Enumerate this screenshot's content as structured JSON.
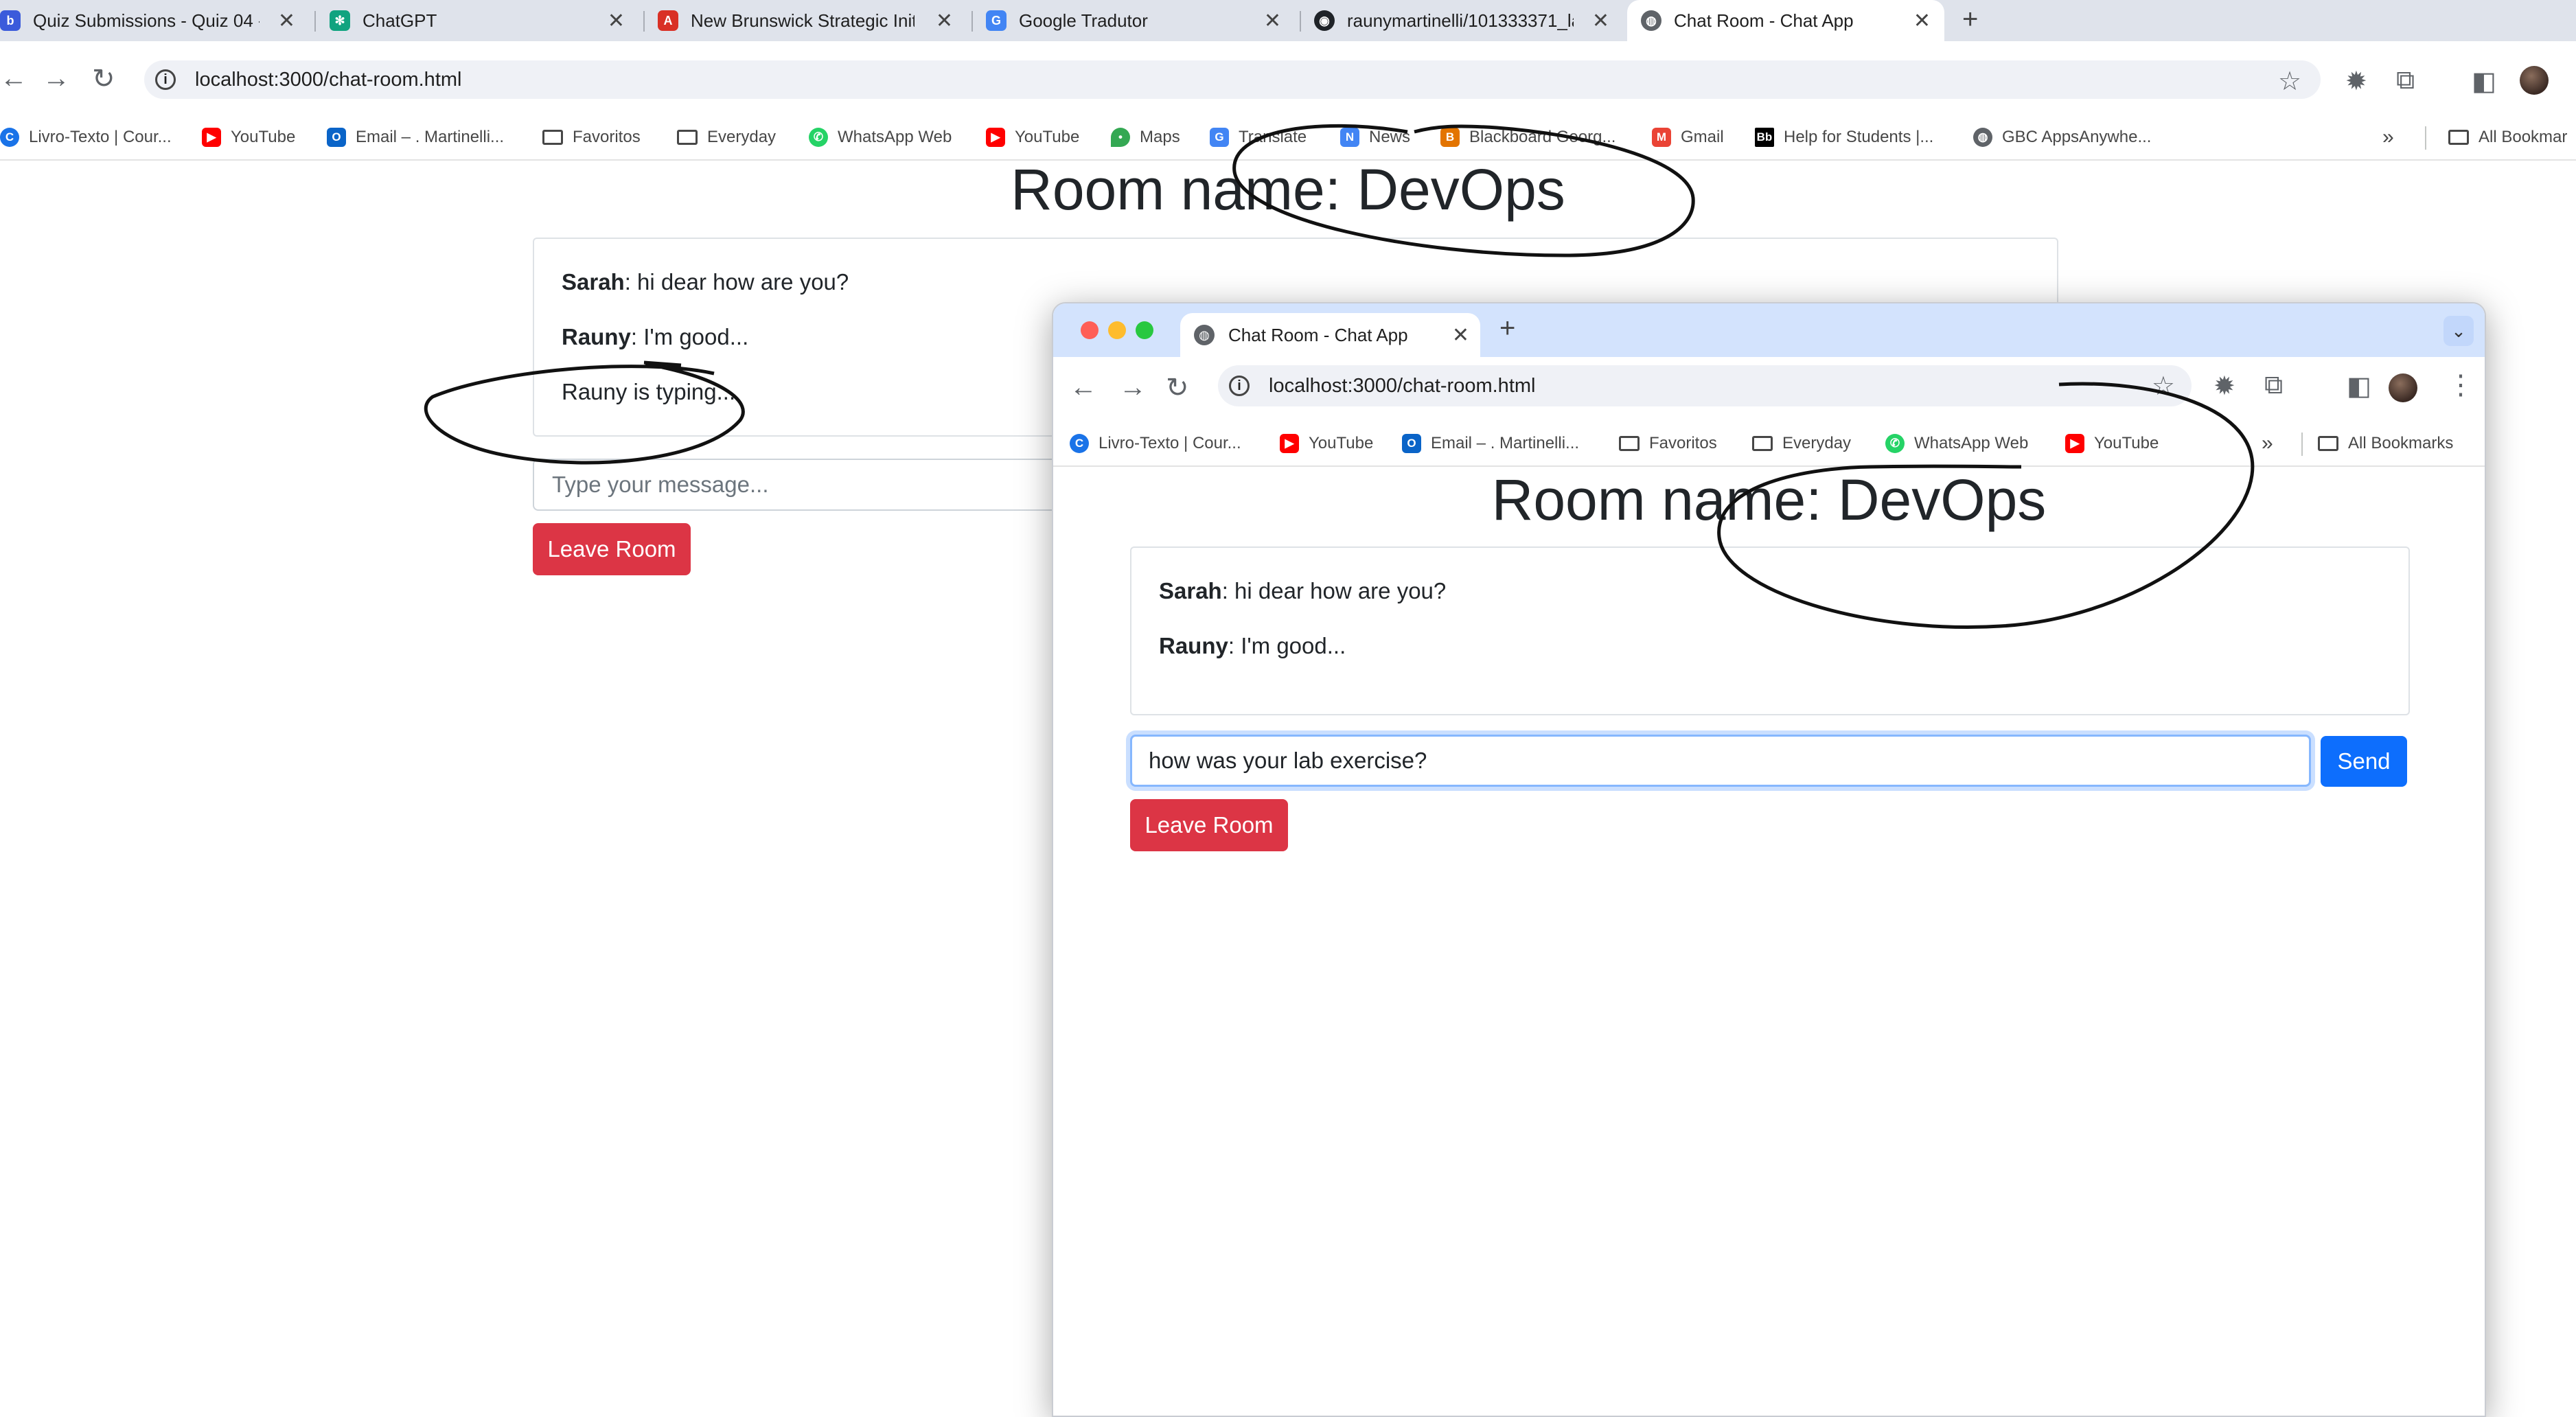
{
  "main_window": {
    "tabs": [
      {
        "label": "Quiz Submissions - Quiz 04 -",
        "icon": "brightspace-icon",
        "color": "#3b5bdb"
      },
      {
        "label": "ChatGPT",
        "icon": "chatgpt-icon",
        "color": "#10a37f"
      },
      {
        "label": "New Brunswick Strategic Initi",
        "icon": "pdf-icon",
        "color": "#d93025"
      },
      {
        "label": "Google Tradutor",
        "icon": "google-translate-icon",
        "color": "#4285f4"
      },
      {
        "label": "raunymartinelli/101333371_la",
        "icon": "github-icon",
        "color": "#1f2328"
      },
      {
        "label": "Chat Room - Chat App",
        "icon": "globe-icon",
        "color": "#5f6368"
      }
    ],
    "url": "localhost:3000/chat-room.html",
    "bookmarks": [
      {
        "label": "Livro-Texto | Cour...",
        "icon": "cengage-icon",
        "color": "#1a73e8"
      },
      {
        "label": "YouTube",
        "icon": "youtube-icon",
        "color": "#ff0000"
      },
      {
        "label": "Email – . Martinelli...",
        "icon": "outlook-icon",
        "color": "#0a64c8"
      },
      {
        "label": "Favoritos",
        "icon": "folder-icon"
      },
      {
        "label": "Everyday",
        "icon": "folder-icon"
      },
      {
        "label": "WhatsApp Web",
        "icon": "whatsapp-icon",
        "color": "#25d366"
      },
      {
        "label": "YouTube",
        "icon": "youtube-icon",
        "color": "#ff0000"
      },
      {
        "label": "Maps",
        "icon": "maps-icon",
        "color": "#34a853"
      },
      {
        "label": "Translate",
        "icon": "translate-icon",
        "color": "#4285f4"
      },
      {
        "label": "News",
        "icon": "news-icon",
        "color": "#4285f4"
      },
      {
        "label": "Blackboard Georg...",
        "icon": "blackboard-icon",
        "color": "#e37400"
      },
      {
        "label": "Gmail",
        "icon": "gmail-icon",
        "color": "#ea4335"
      },
      {
        "label": "Help for Students |...",
        "icon": "bb-icon",
        "color": "#000000"
      },
      {
        "label": "GBC AppsAnywhe...",
        "icon": "globe-icon",
        "color": "#5f6368"
      }
    ],
    "all_bookmarks": "All Bookmar",
    "page": {
      "title": "Room name: DevOps",
      "messages": [
        {
          "sender": "Sarah",
          "text": ": hi dear how are you?"
        },
        {
          "sender": "Rauny",
          "text": ": I'm good..."
        }
      ],
      "typing": "Rauny is typing...",
      "input_placeholder": "Type your message...",
      "leave_label": "Leave Room"
    }
  },
  "overlay_window": {
    "tab": "Chat Room - Chat App",
    "url": "localhost:3000/chat-room.html",
    "bookmarks": [
      {
        "label": "Livro-Texto | Cour...",
        "icon": "cengage-icon",
        "color": "#1a73e8"
      },
      {
        "label": "YouTube",
        "icon": "youtube-icon",
        "color": "#ff0000"
      },
      {
        "label": "Email – . Martinelli...",
        "icon": "outlook-icon",
        "color": "#0a64c8"
      },
      {
        "label": "Favoritos",
        "icon": "folder-icon"
      },
      {
        "label": "Everyday",
        "icon": "folder-icon"
      },
      {
        "label": "WhatsApp Web",
        "icon": "whatsapp-icon",
        "color": "#25d366"
      },
      {
        "label": "YouTube",
        "icon": "youtube-icon",
        "color": "#ff0000"
      }
    ],
    "all_bookmarks": "All Bookmarks",
    "page": {
      "title": "Room name: DevOps",
      "messages": [
        {
          "sender": "Sarah",
          "text": ": hi dear how are you?"
        },
        {
          "sender": "Rauny",
          "text": ": I'm good..."
        }
      ],
      "input_value": "how was your lab exercise?",
      "send_label": "Send",
      "leave_label": "Leave Room"
    }
  }
}
